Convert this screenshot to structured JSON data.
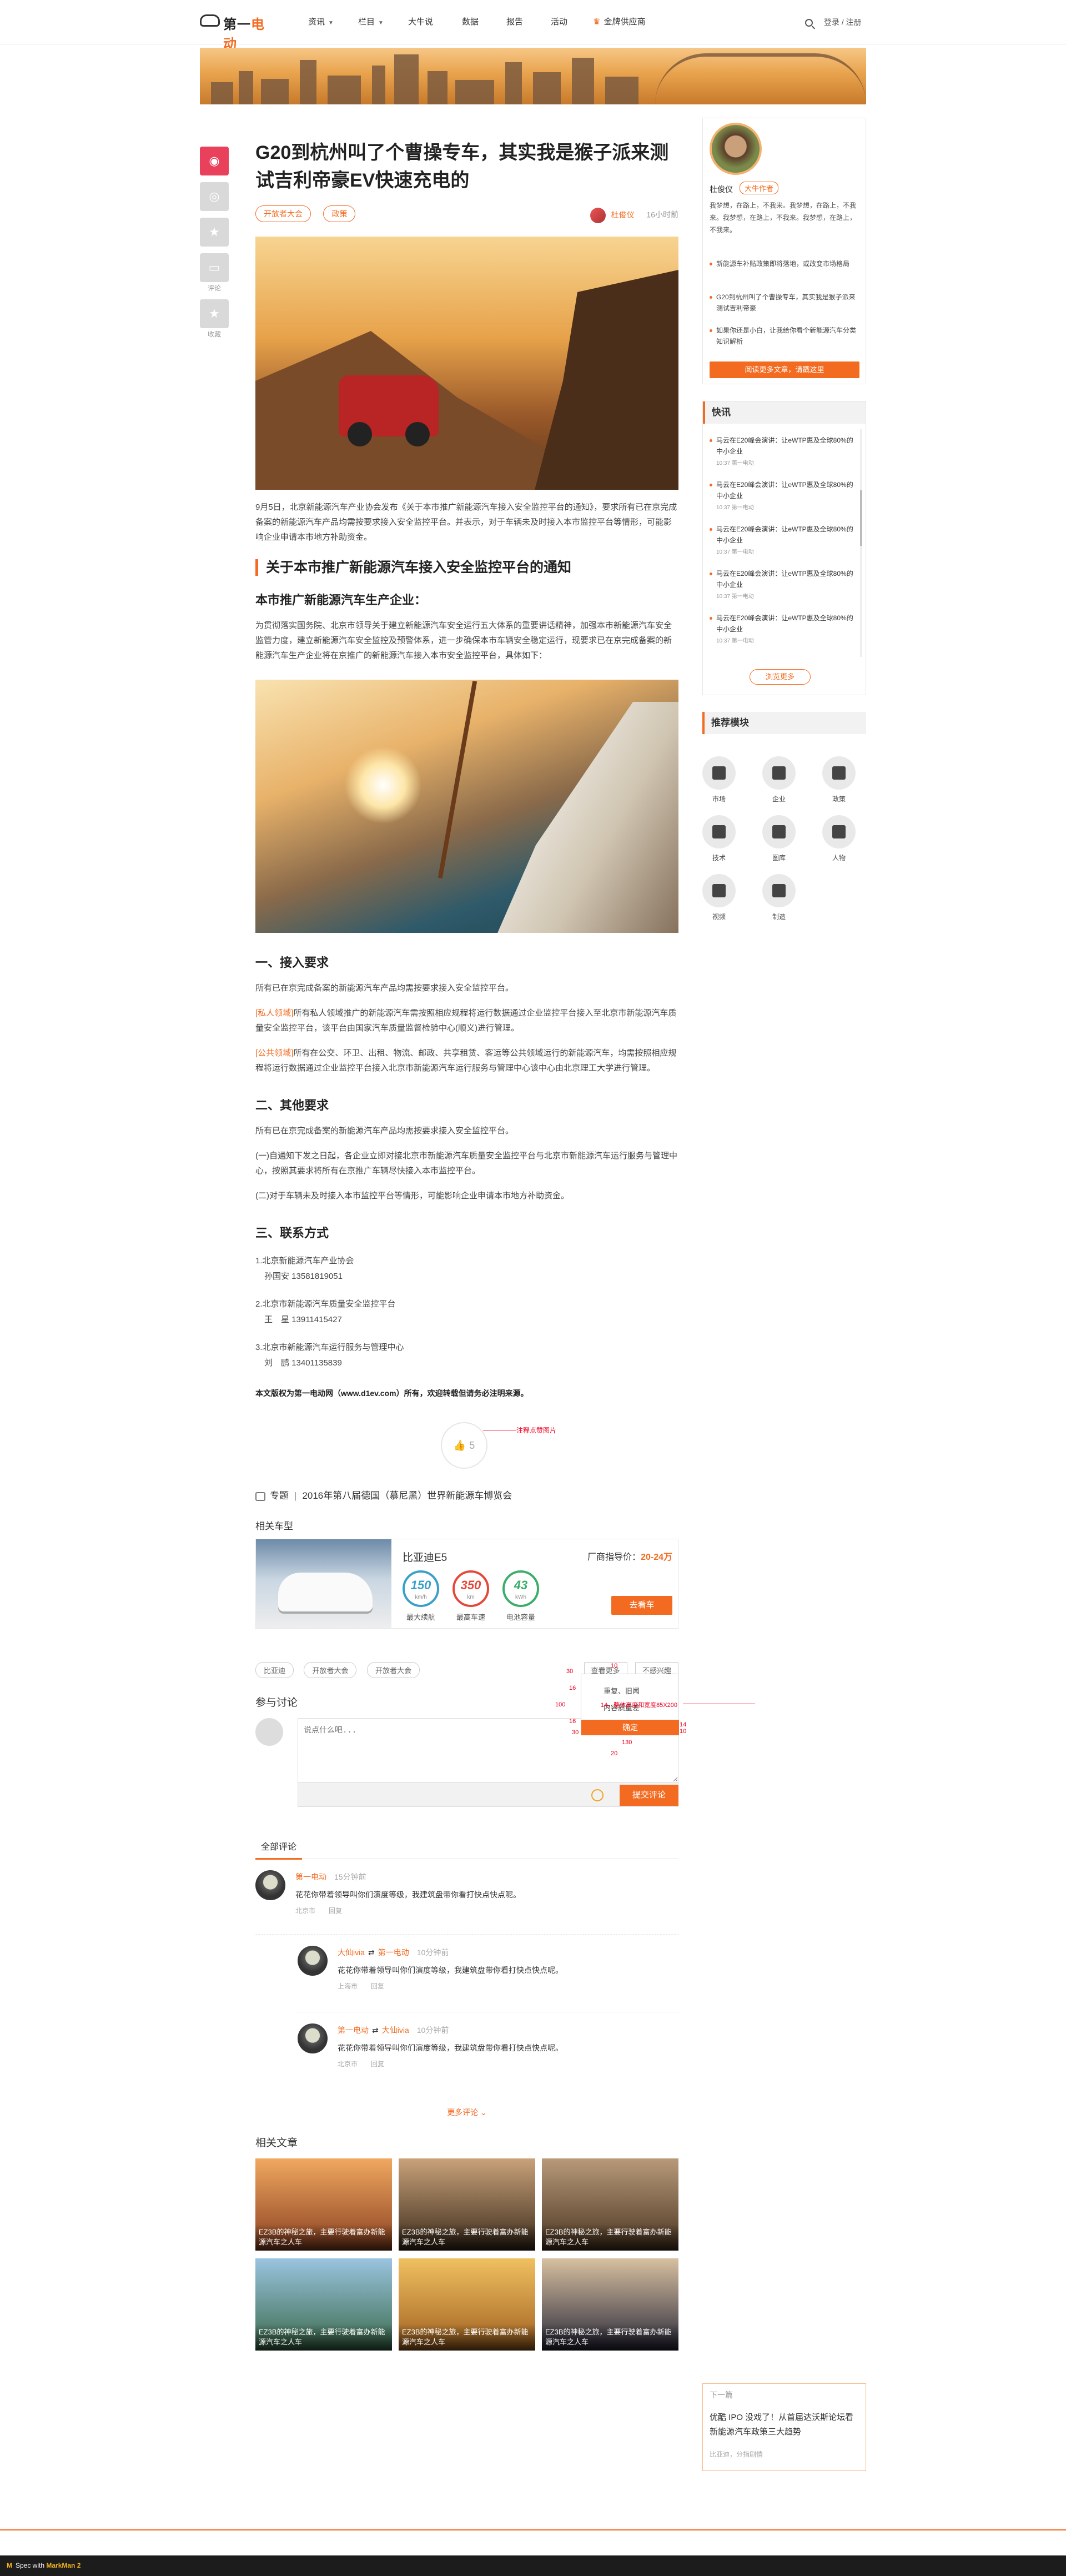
{
  "header": {
    "logo_main": "第一",
    "logo_accent": "电动",
    "nav": [
      "资讯",
      "栏目",
      "大牛说",
      "数据",
      "报告",
      "活动",
      "金牌供应商"
    ],
    "login": "登录 / 注册"
  },
  "share": {
    "comment": "评论",
    "collect": "收藏"
  },
  "article": {
    "title": "G20到杭州叫了个曹操专车，其实我是猴子派来测试吉利帝豪EV快速充电的",
    "tags": [
      "开放者大会",
      "政策"
    ],
    "author": "杜俊仪",
    "time": "16小时前",
    "intro": "9月5日，北京新能源汽车产业协会发布《关于本市推广新能源汽车接入安全监控平台的通知》，要求所有已在京完成备案的新能源汽车产品均需按要求接入安全监控平台。并表示，对于车辆未及时接入本市监控平台等情形，可能影响企业申请本市地方补助资金。",
    "notice_title": "关于本市推广新能源汽车接入安全监控平台的通知",
    "sub_title": "本市推广新能源汽车生产企业：",
    "notice_body": "为贯彻落实国务院、北京市领导关于建立新能源汽车安全运行五大体系的重要讲话精神，加强本市新能源汽车安全监管力度，建立新能源汽车安全监控及预警体系，进一步确保本市车辆安全稳定运行，现要求已在京完成备案的新能源汽车生产企业将在京推广的新能源汽车接入本市安全监控平台，具体如下：",
    "sec1": "一、接入要求",
    "sec1_p1": "所有已在京完成备案的新能源汽车产品均需按要求接入安全监控平台。",
    "sec1_p2_tag": "[私人领域]",
    "sec1_p2": "所有私人领域推广的新能源汽车需按照相应规程将运行数据通过企业监控平台接入至北京市新能源汽车质量安全监控平台，该平台由国家汽车质量监督检验中心(顺义)进行管理。",
    "sec1_p3_tag": "[公共领域]",
    "sec1_p3": "所有在公交、环卫、出租、物流、邮政、共享租赁、客运等公共领域运行的新能源汽车，均需按照相应规程将运行数据通过企业监控平台接入北京市新能源汽车运行服务与管理中心该中心由北京理工大学进行管理。",
    "sec2": "二、其他要求",
    "sec2_p1": "所有已在京完成备案的新能源汽车产品均需按要求接入安全监控平台。",
    "sec2_p2": "(一)自通知下发之日起，各企业立即对接北京市新能源汽车质量安全监控平台与北京市新能源汽车运行服务与管理中心，按照其要求将所有在京推广车辆尽快接入本市监控平台。",
    "sec2_p3": "(二)对于车辆未及时接入本市监控平台等情形，可能影响企业申请本市地方补助资金。",
    "sec3": "三、联系方式",
    "contacts": [
      {
        "org": "1.北京新能源汽车产业协会",
        "person": "孙国安 13581819051"
      },
      {
        "org": "2.北京市新能源汽车质量安全监控平台",
        "person": "王　星 13911415427"
      },
      {
        "org": "3.北京市新能源汽车运行服务与管理中心",
        "person": "刘　鹏 13401135839"
      }
    ],
    "copyright": "本文版权为第一电动网（www.d1ev.com）所有，欢迎转载但请务必注明来源。",
    "likes": "5",
    "like_note": "注释点赞图片"
  },
  "topic": {
    "label": "专题",
    "text": "2016年第八届德国（慕尼黑）世界新能源车博览会"
  },
  "related_car": {
    "heading": "相关车型",
    "name": "比亚迪E5",
    "price_label": "厂商指导价：",
    "price": "20-24万",
    "gauges": [
      {
        "value": "150",
        "unit": "km/h",
        "label": "最大续航",
        "color": "#3aa0c8"
      },
      {
        "value": "350",
        "unit": "km",
        "label": "最高车速",
        "color": "#e5483b"
      },
      {
        "value": "43",
        "unit": "kWh",
        "label": "电池容量",
        "color": "#3aae6a"
      }
    ],
    "buy": "去看车"
  },
  "keywords": [
    "比亚迪",
    "开放者大会",
    "开放者大会"
  ],
  "kw_buttons": [
    "查看更多",
    "不感兴趣"
  ],
  "discuss": {
    "heading": "参与讨论",
    "placeholder": "说点什么吧...",
    "submit": "提交评论",
    "popup_t1": "重复、旧闻",
    "popup_t2": "内容质量差",
    "popup_ok": "确定",
    "annotation": "14，整体高度和宽度85X200",
    "dims": [
      "30",
      "10",
      "16",
      "100",
      "16",
      "30",
      "14",
      "10",
      "130",
      "20"
    ]
  },
  "comments": {
    "tab": "全部评论",
    "items": [
      {
        "name": "第一电动",
        "reply": "",
        "time": "15分钟前",
        "text": "花花你带着领导叫你们演度等级，我建筑盘带你看打快点快点呢。",
        "meta": "北京市　　回复"
      },
      {
        "name": "大仙ivia",
        "reply": "第一电动",
        "time": "10分钟前",
        "text": "花花你带着领导叫你们演度等级，我建筑盘带你看打快点快点呢。",
        "meta": "上海市　　回复"
      },
      {
        "name": "第一电动",
        "reply": "大仙ivia",
        "time": "10分钟前",
        "text": "花花你带着领导叫你们演度等级，我建筑盘带你看打快点快点呢。",
        "meta": "北京市　　回复"
      }
    ],
    "more": "更多评论"
  },
  "related_articles": {
    "heading": "相关文章",
    "items": [
      "EZ3B的神秘之旅，主要行驶着富办新能源汽车之人车",
      "EZ3B的神秘之旅，主要行驶着富办新能源汽车之人车",
      "EZ3B的神秘之旅，主要行驶着富办新能源汽车之人车",
      "EZ3B的神秘之旅，主要行驶着富办新能源汽车之人车",
      "EZ3B的神秘之旅，主要行驶着富办新能源汽车之人车",
      "EZ3B的神秘之旅，主要行驶着富办新能源汽车之人车"
    ]
  },
  "sidebar": {
    "name": "杜俊仪",
    "badge": "大牛作者",
    "desc": "我梦想，在路上，不我来。我梦想，在路上，不我来。我梦想，在路上，不我来。我梦想，在路上，不我来。",
    "links": [
      "新能源车补贴政策即将落地，或改变市场格局",
      "G20到杭州叫了个曹操专车，其实我是猴子派来测试吉利帝豪",
      "如果你还是小白，让我给你看个新能源汽车分类知识解析"
    ],
    "more_btn": "阅读更多文章，请戳这里",
    "flash_title": "快讯",
    "flash": [
      {
        "t": "马云在E20峰会演讲：让eWTP惠及全球80%的中小企业",
        "d": "10:37 第一电动"
      },
      {
        "t": "马云在E20峰会演讲：让eWTP惠及全球80%的中小企业",
        "d": "10:37 第一电动"
      },
      {
        "t": "马云在E20峰会演讲：让eWTP惠及全球80%的中小企业",
        "d": "10:37 第一电动"
      },
      {
        "t": "马云在E20峰会演讲：让eWTP惠及全球80%的中小企业",
        "d": "10:37 第一电动"
      },
      {
        "t": "马云在E20峰会演讲：让eWTP惠及全球80%的中小企业",
        "d": "10:37 第一电动"
      }
    ],
    "flash_more": "浏览更多",
    "rec_title": "推荐模块",
    "rec": [
      "市场",
      "企业",
      "政策",
      "技术",
      "图库",
      "人物",
      "视频",
      "制造"
    ]
  },
  "next": {
    "label": "下一篇",
    "title": "优酷 IPO 没戏了！从首届达沃斯论坛看新能源汽车政策三大趋势",
    "meta": "比亚迪，分指剧情"
  },
  "footer": {
    "brand": "Spec with",
    "tool": "MarkMan 2"
  }
}
